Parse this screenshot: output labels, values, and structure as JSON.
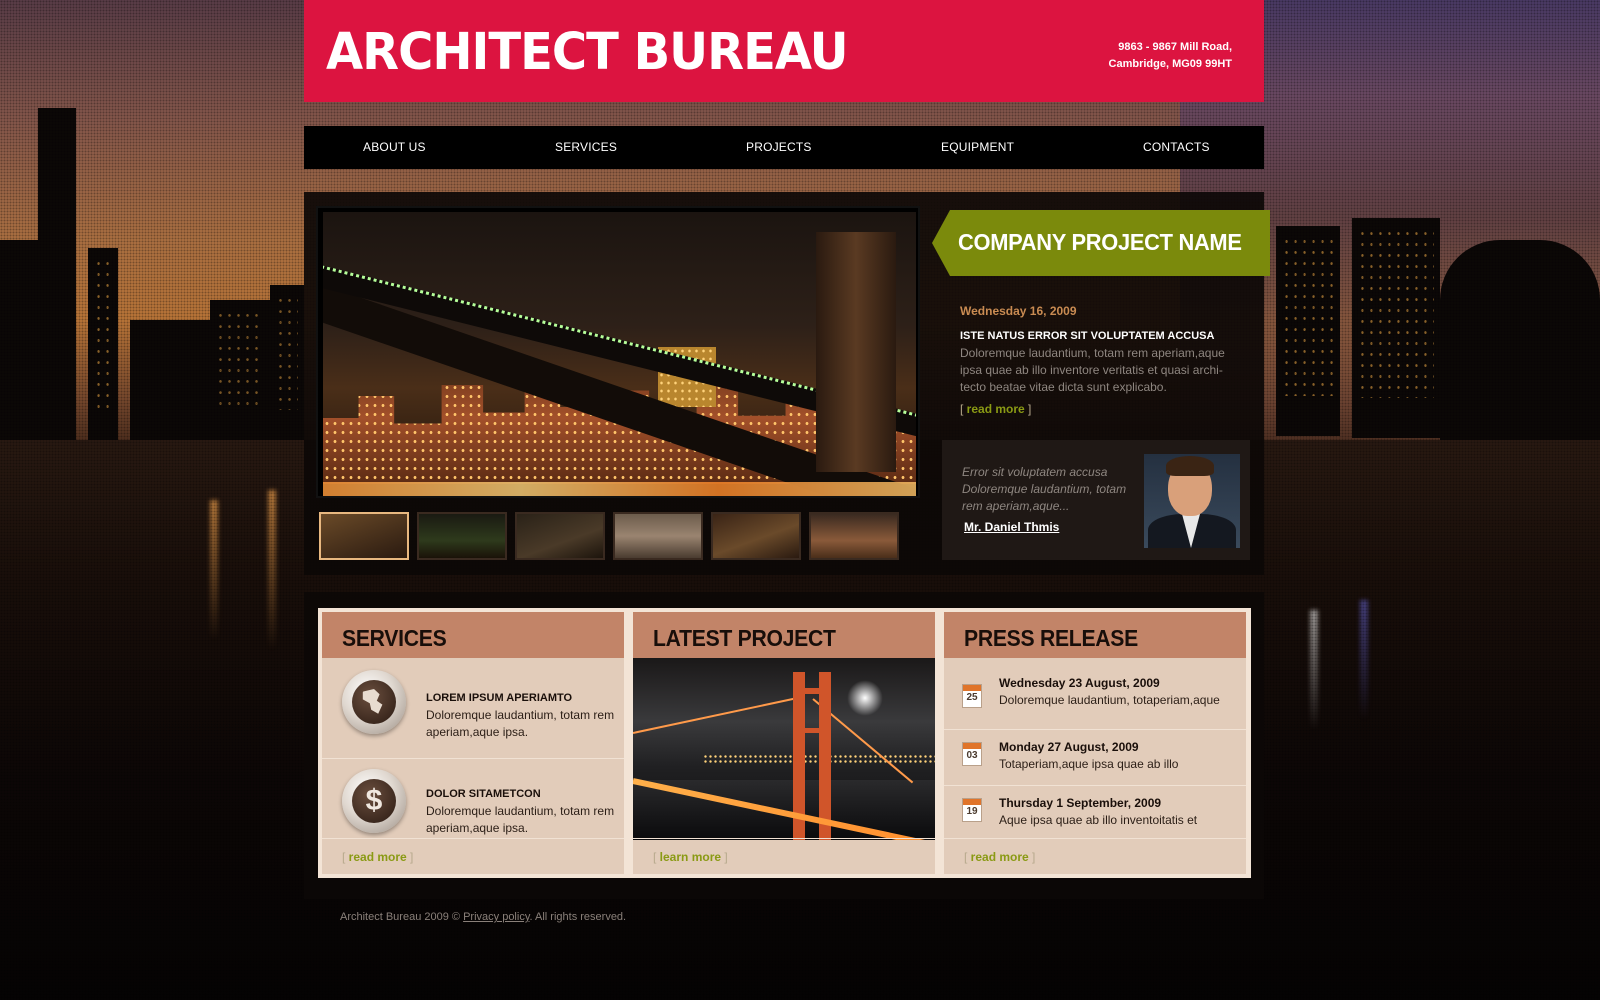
{
  "header": {
    "logo": "ARCHITECT BUREAU",
    "address_line1": "9863 - 9867 Mill Road,",
    "address_line2": "Cambridge, MG09 99HT",
    "color": "#dc1440"
  },
  "nav": {
    "items": [
      {
        "label": "ABOUT US"
      },
      {
        "label": "SERVICES"
      },
      {
        "label": "PROJECTS"
      },
      {
        "label": "EQUIPMENT"
      },
      {
        "label": "CONTACTS"
      }
    ]
  },
  "feature": {
    "banner_title": "COMPANY PROJECT NAME",
    "banner_color": "#7b8a0c",
    "date": "Wednesday 16, 2009",
    "heading": "ISTE NATUS ERROR SIT VOLUPTATEM ACCUSA",
    "text": "Doloremque laudantium, totam rem aperiam,aque ipsa quae ab illo inventore veritatis et quasi archi-tecto beatae vitae dicta sunt explicabo.",
    "read_more": "read more",
    "thumbnails_count": 6
  },
  "testimonial": {
    "quote": "Error sit voluptatem accusa Doloremque laudantium, totam rem aperiam,aque...",
    "author": "Mr. Daniel Thmis"
  },
  "services": {
    "title": "SERVICES",
    "items": [
      {
        "icon": "globe-icon",
        "title": "LOREM IPSUM APERIAMTO",
        "text": "Doloremque laudantium, totam rem aperiam,aque ipsa."
      },
      {
        "icon": "dollar-icon",
        "title": "DOLOR SITAMETCON",
        "text": "Doloremque laudantium, totam rem aperiam,aque ipsa."
      }
    ],
    "read_more": "read more"
  },
  "latest_project": {
    "title": "LATEST PROJECT",
    "link": "learn more"
  },
  "press_release": {
    "title": "PRESS RELEASE",
    "items": [
      {
        "day": "25",
        "date": "Wednesday 23 August, 2009",
        "text": "Doloremque laudantium, totaperiam,aque"
      },
      {
        "day": "03",
        "date": "Monday 27 August, 2009",
        "text": "Totaperiam,aque ipsa quae ab illo"
      },
      {
        "day": "19",
        "date": "Thursday  1 September, 2009",
        "text": "Aque ipsa quae ab illo inventoitatis et"
      }
    ],
    "read_more": "read more"
  },
  "footer": {
    "copyright": "Architect Bureau 2009 ©",
    "privacy": "Privacy policy",
    "rights": ". All rights reserved."
  }
}
